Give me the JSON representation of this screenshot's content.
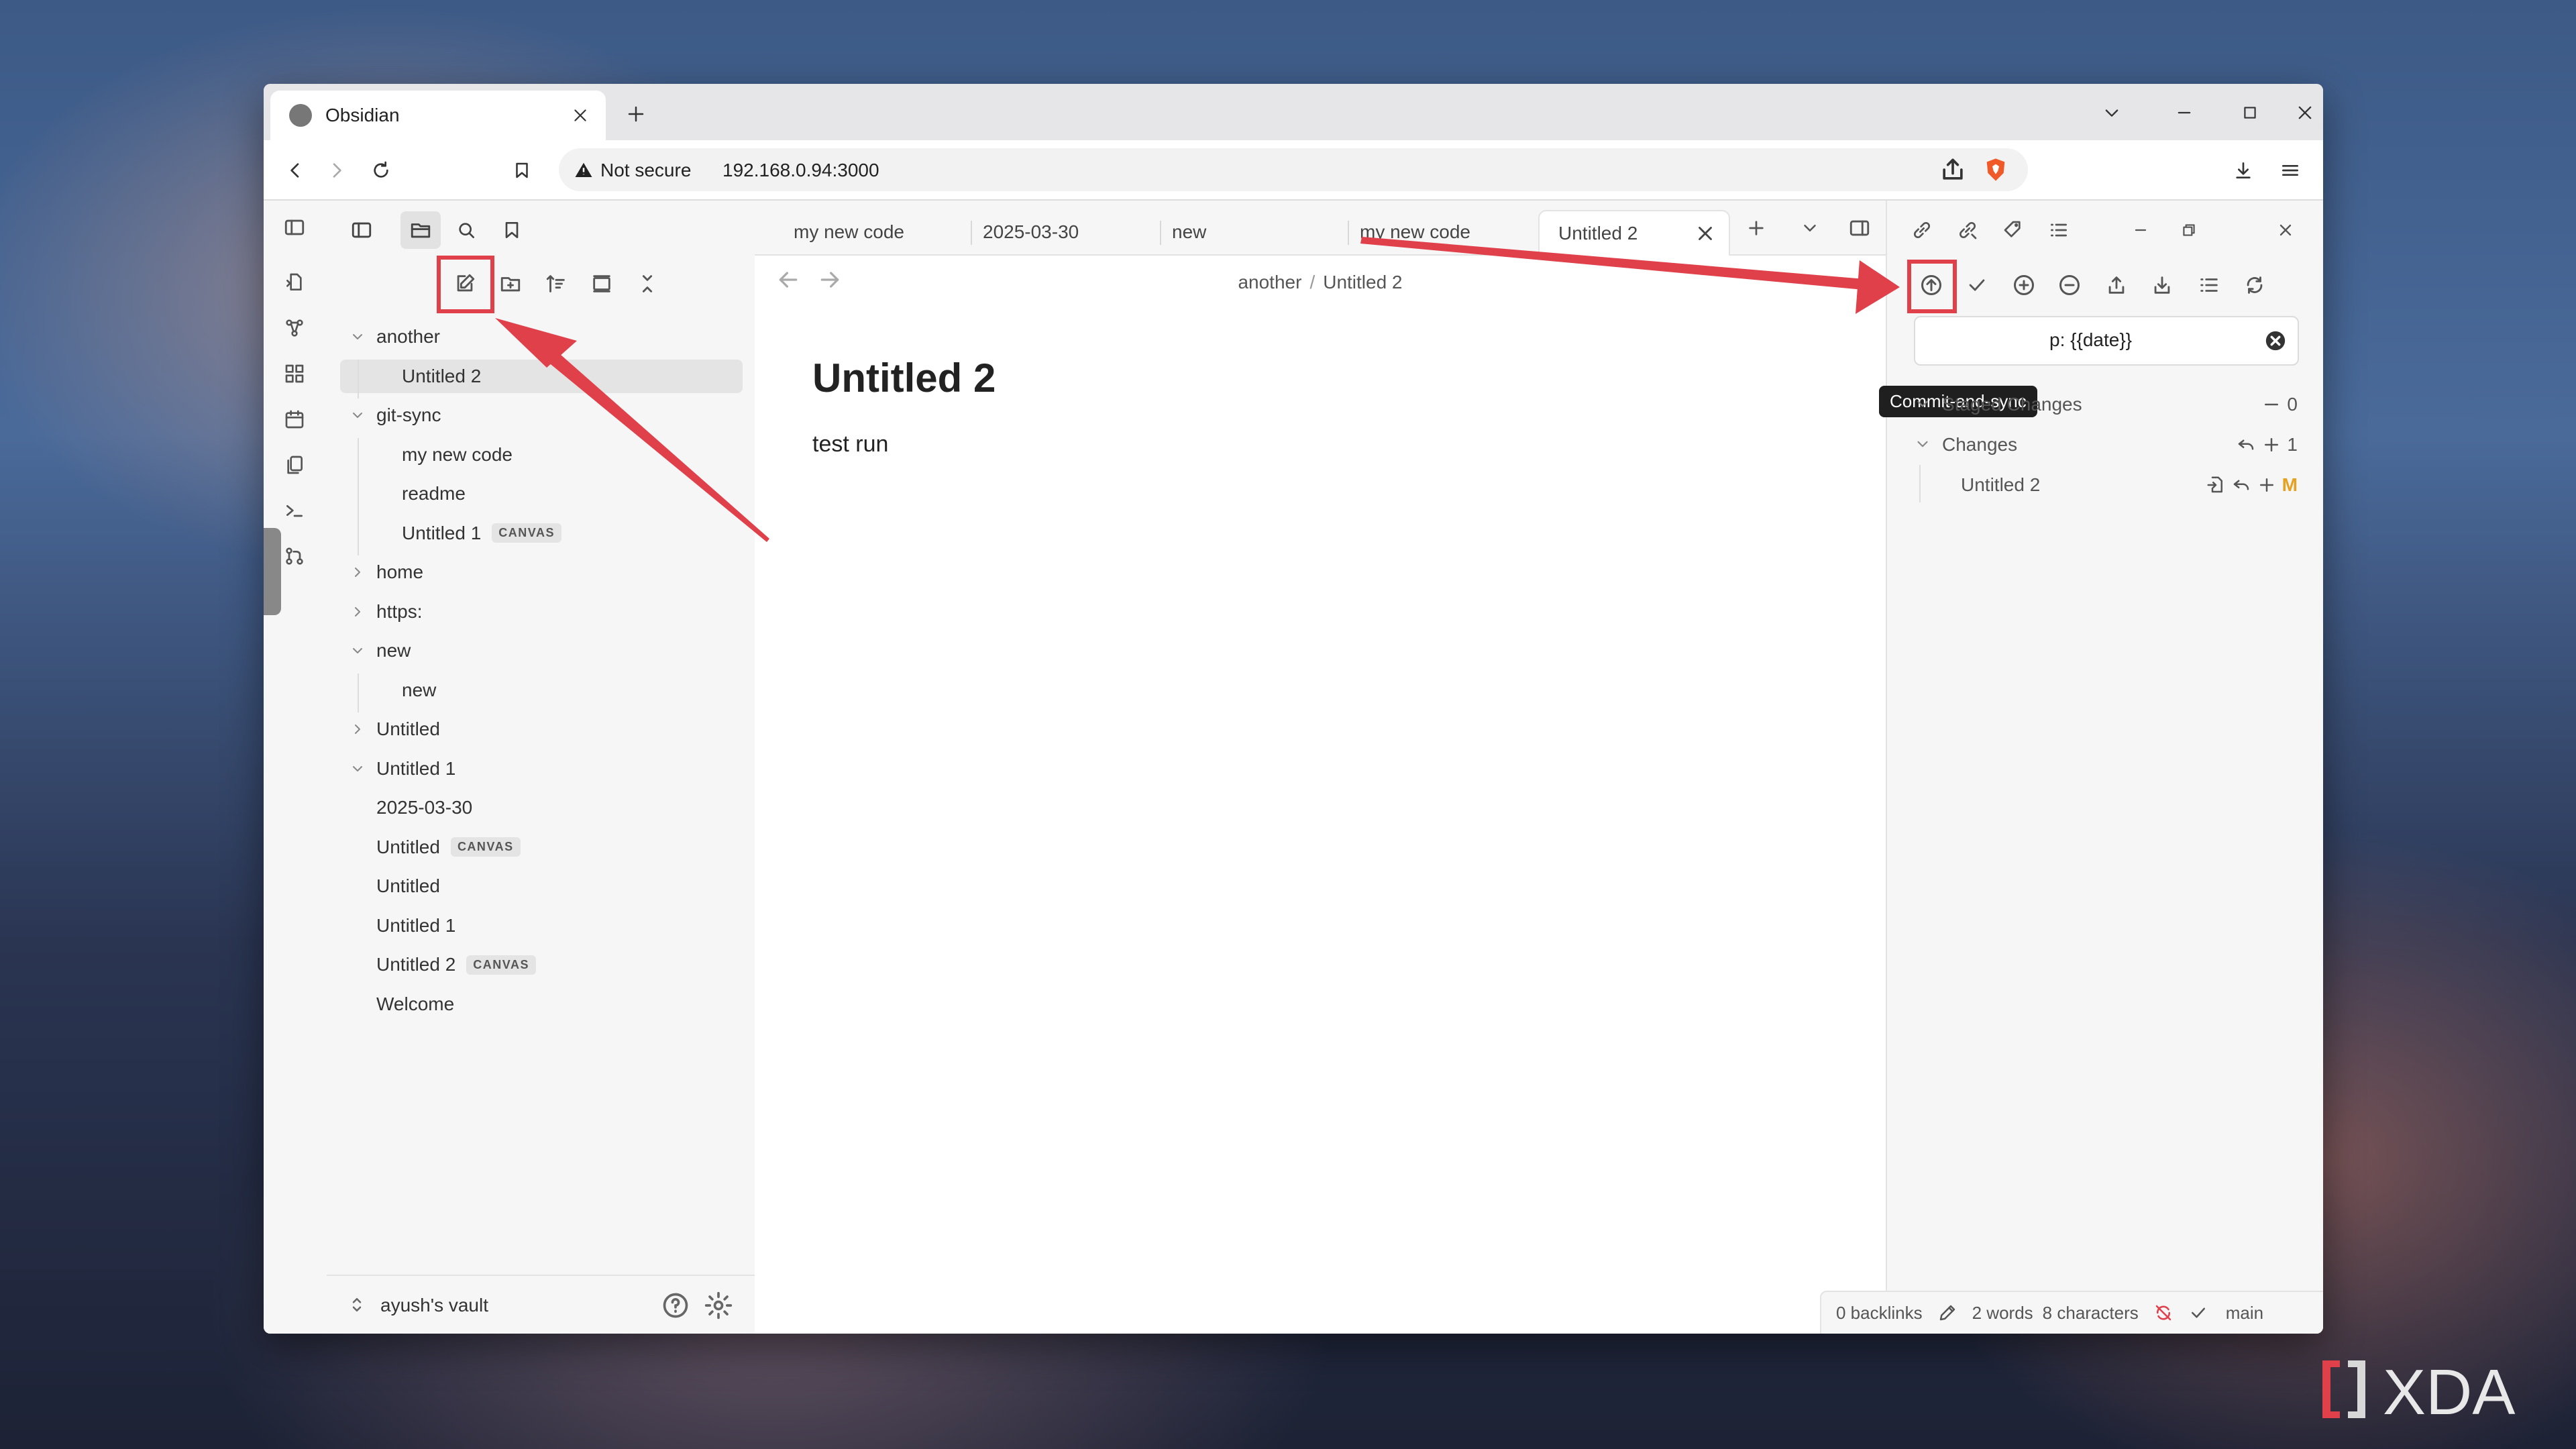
{
  "browser": {
    "tab_title": "Obsidian",
    "security_label": "Not secure",
    "url": "192.168.0.94:3000"
  },
  "obsidian": {
    "file_tree": [
      {
        "label": "another",
        "type": "folder",
        "expanded": true
      },
      {
        "label": "Untitled 2",
        "type": "file",
        "selected": true
      },
      {
        "label": "git-sync",
        "type": "folder",
        "expanded": true
      },
      {
        "label": "my new code",
        "type": "file"
      },
      {
        "label": "readme",
        "type": "file"
      },
      {
        "label": "Untitled 1",
        "type": "file",
        "badge": "CANVAS"
      },
      {
        "label": "home",
        "type": "folder",
        "expanded": false
      },
      {
        "label": "https:",
        "type": "folder",
        "expanded": false
      },
      {
        "label": "new",
        "type": "folder",
        "expanded": true
      },
      {
        "label": "new",
        "type": "file"
      },
      {
        "label": "Untitled",
        "type": "folder",
        "expanded": false
      },
      {
        "label": "Untitled 1",
        "type": "folder",
        "expanded": true
      },
      {
        "label": "2025-03-30",
        "type": "file"
      },
      {
        "label": "Untitled",
        "type": "file",
        "badge": "CANVAS"
      },
      {
        "label": "Untitled",
        "type": "file"
      },
      {
        "label": "Untitled 1",
        "type": "file"
      },
      {
        "label": "Untitled 2",
        "type": "file",
        "badge": "CANVAS"
      },
      {
        "label": "Welcome",
        "type": "file"
      }
    ],
    "vault_name": "ayush's vault",
    "tabs": [
      "my new code",
      "2025-03-30",
      "new",
      "my new code",
      "Untitled 2"
    ],
    "breadcrumb": {
      "folder": "another",
      "separator": "/",
      "file": "Untitled 2"
    },
    "note": {
      "title": "Untitled 2",
      "body": "test run"
    },
    "git_panel": {
      "tooltip": "Commit-and-sync",
      "commit_message": "p: {{date}}",
      "staged_label": "Staged Changes",
      "staged_count": "0",
      "changes_label": "Changes",
      "changes_count": "1",
      "changed_file": "Untitled 2",
      "changed_status": "M"
    },
    "status_bar": {
      "backlinks": "0 backlinks",
      "words": "2 words",
      "characters": "8 characters",
      "branch": "main"
    }
  },
  "watermark": {
    "text": "XDA"
  },
  "colors": {
    "annotation_red": "#e0404a",
    "modified_orange": "#e8a020"
  }
}
